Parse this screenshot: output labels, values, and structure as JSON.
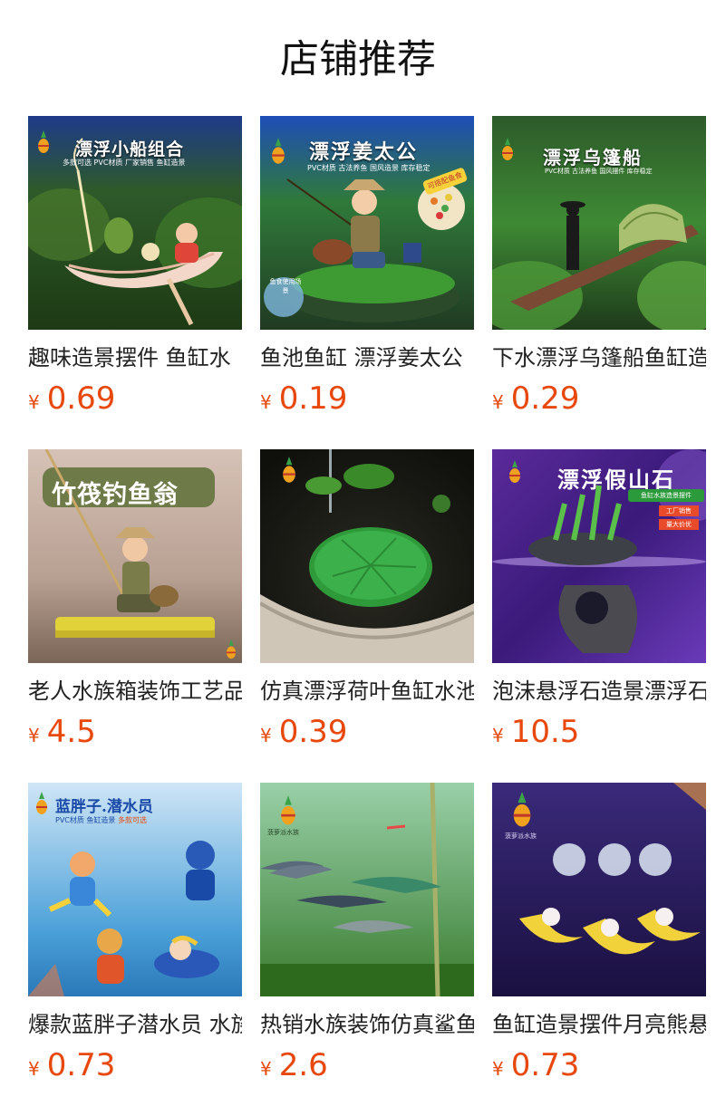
{
  "page": {
    "title": "店铺推荐"
  },
  "colors": {
    "price": "#e8480c",
    "title": "#111111",
    "name": "#222222"
  },
  "products": [
    {
      "name": "趣味造景摆件 鱼缸水",
      "currency": "¥",
      "price": "0.69",
      "banner": "漂浮小船组合",
      "tagline": "多款可选 PVC材质 厂家销售 鱼缸造景",
      "icon": "pineapple-logo-icon"
    },
    {
      "name": "鱼池鱼缸 漂浮姜太公",
      "currency": "¥",
      "price": "0.19",
      "banner": "漂浮姜太公",
      "tagline": "PVC材质 古法养鱼 国风造景 库存稳定",
      "badge": "可搭配鱼食",
      "corner": "鱼食使用场景",
      "icon": "pineapple-logo-icon"
    },
    {
      "name": "下水漂浮乌篷船鱼缸造",
      "currency": "¥",
      "price": "0.29",
      "banner": "漂浮乌篷船",
      "tagline": "PVC材质 古法养鱼 国风摆件 库存稳定",
      "icon": "pineapple-logo-icon"
    },
    {
      "name": "老人水族箱装饰工艺品",
      "currency": "¥",
      "price": "4.5",
      "banner": "竹筏钓鱼翁",
      "icon": "pineapple-logo-icon"
    },
    {
      "name": "仿真漂浮荷叶鱼缸水池",
      "currency": "¥",
      "price": "0.39",
      "icon": "pineapple-logo-icon"
    },
    {
      "name": "泡沫悬浮石造景漂浮石",
      "currency": "¥",
      "price": "10.5",
      "banner": "漂浮假山石",
      "tagline": "鱼缸水族造景摆件",
      "tags": [
        "工厂销售",
        "量大价优"
      ],
      "icon": "pineapple-logo-icon"
    },
    {
      "name": "爆款蓝胖子潜水员 水族",
      "currency": "¥",
      "price": "0.73",
      "banner": "蓝胖子.潜水员",
      "tagline": "PVC材质 鱼缸造景",
      "highlight": "多款可选",
      "icon": "pineapple-logo-icon"
    },
    {
      "name": "热销水族装饰仿真鲨鱼",
      "currency": "¥",
      "price": "2.6",
      "brand": "菠萝派水族",
      "icon": "pineapple-logo-icon"
    },
    {
      "name": "鱼缸造景摆件月亮熊悬",
      "currency": "¥",
      "price": "0.73",
      "brand": "菠萝派水族",
      "icon": "pineapple-logo-icon"
    }
  ]
}
